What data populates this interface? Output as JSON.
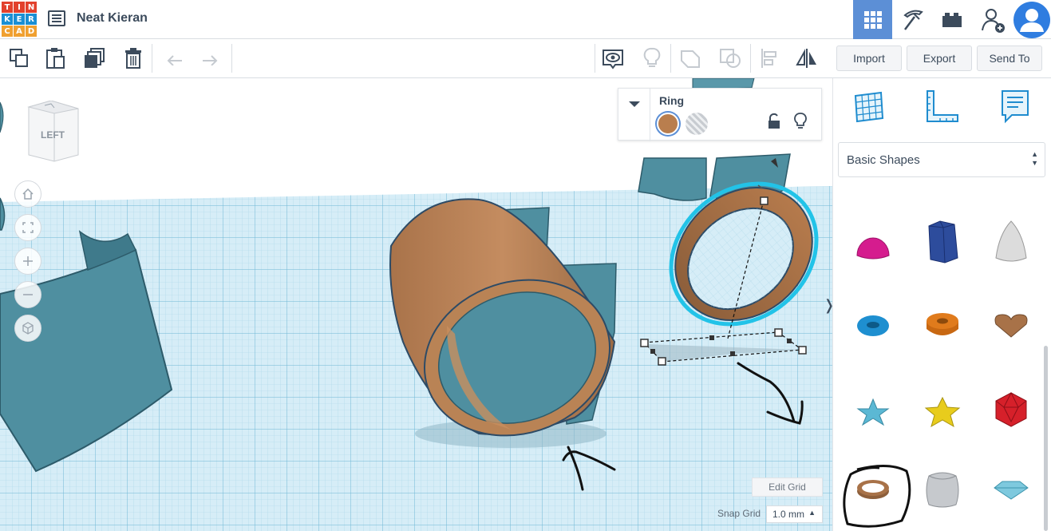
{
  "app": {
    "logo_letters": [
      "T",
      "I",
      "N",
      "K",
      "E",
      "R",
      "C",
      "A",
      "D"
    ],
    "logo_colors": [
      "#e2412d",
      "#e2412d",
      "#e2412d",
      "#1a8fd4",
      "#1a8fd4",
      "#1a8fd4",
      "#f0a030",
      "#f0a030",
      "#f0a030"
    ],
    "project_name": "Neat Kieran"
  },
  "topbar": {
    "icons": [
      "grid-view-icon",
      "pickaxe-icon",
      "bricks-icon",
      "add-user-icon",
      "user-avatar-icon"
    ],
    "active_color": "#5c8fd6"
  },
  "toolbar": {
    "buttons": [
      "copy-icon",
      "paste-icon",
      "duplicate-icon",
      "delete-icon",
      "undo-icon",
      "redo-icon",
      "show-all-icon",
      "light-bulb-icon",
      "group-icon",
      "ungroup-icon",
      "align-icon",
      "mirror-icon"
    ],
    "import_label": "Import",
    "export_label": "Export",
    "send_to_label": "Send To"
  },
  "viewcube": {
    "face_label": "LEFT"
  },
  "inspector": {
    "title": "Ring",
    "solid_color": "#b97e4e",
    "hole_label": "hole-icon"
  },
  "grid": {
    "edit_grid_label": "Edit Grid",
    "snap_grid_label": "Snap Grid",
    "snap_value": "1.0 mm"
  },
  "shapes_panel": {
    "category": "Basic Shapes",
    "shapes": [
      {
        "name": "half-sphere",
        "color": "#d51c8e"
      },
      {
        "name": "polygon",
        "color": "#2d4c9c"
      },
      {
        "name": "paraboloid",
        "color": "#d8d8d8"
      },
      {
        "name": "torus",
        "color": "#1e8fd0"
      },
      {
        "name": "tube",
        "color": "#e07b1c"
      },
      {
        "name": "heart",
        "color": "#a87248"
      },
      {
        "name": "star",
        "color": "#5bb8d4"
      },
      {
        "name": "star-gold",
        "color": "#e8cc1c"
      },
      {
        "name": "icosahedron",
        "color": "#d6202a"
      },
      {
        "name": "ring",
        "color": "#a87248"
      },
      {
        "name": "rounded-box",
        "color": "#c6c9cd"
      },
      {
        "name": "diamond",
        "color": "#7ec9de"
      }
    ]
  }
}
